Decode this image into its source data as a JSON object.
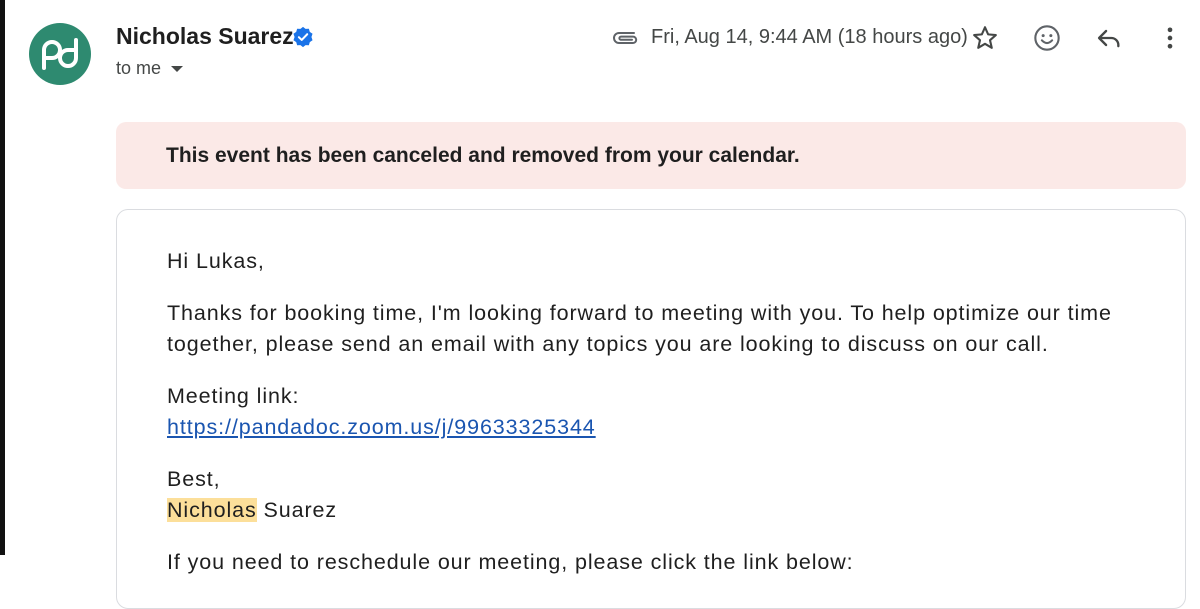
{
  "sender": {
    "name": "Nicholas Suarez",
    "avatar_icon": "pandadoc-logo-icon",
    "avatar_color": "#2e8a70",
    "recipient_label": "to me"
  },
  "header": {
    "attachment_icon": "paperclip-icon",
    "date": "Fri, Aug 14, 9:44 AM (18 hours ago)",
    "actions": [
      "star-icon",
      "emoji-icon",
      "reply-icon",
      "more-vert-icon"
    ]
  },
  "banner": {
    "text": "This event has been canceled and removed from your calendar.",
    "background": "#fbe9e7"
  },
  "message": {
    "greeting": "Hi Lukas,",
    "paragraph": "Thanks for booking time, I'm looking forward to meeting with you. To help optimize our time together, please send an email with any topics you are looking to discuss on our call.",
    "meeting_label": "Meeting link:",
    "meeting_url": "https://pandadoc.zoom.us/j/99633325344",
    "signoff": "Best,",
    "signature_first": "Nicholas",
    "signature_last": " Suarez",
    "reschedule_text": "If you need to reschedule our meeting, please click the link below:"
  },
  "colors": {
    "link": "#1a55b0",
    "highlight": "#fcdf9a",
    "verified_badge": "#1a73e8"
  }
}
